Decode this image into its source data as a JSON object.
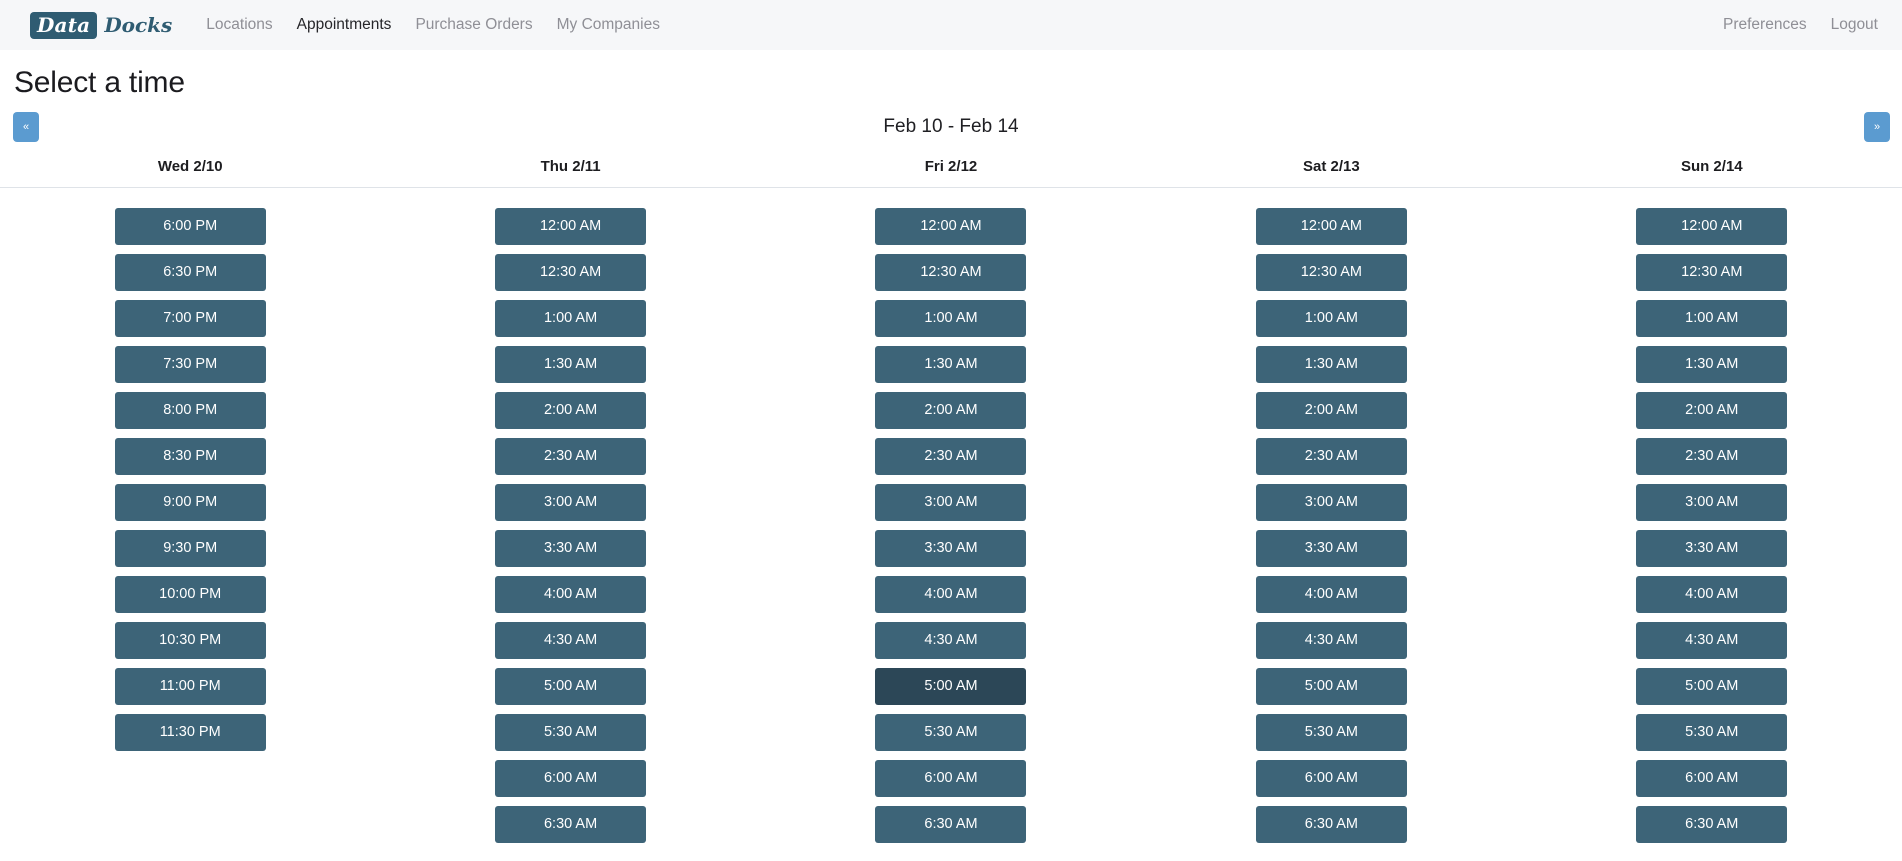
{
  "navbar": {
    "brand": {
      "box_text": "Data",
      "word_text": "Docks"
    },
    "links": [
      {
        "label": "Locations",
        "active": false
      },
      {
        "label": "Appointments",
        "active": true
      },
      {
        "label": "Purchase Orders",
        "active": false
      },
      {
        "label": "My Companies",
        "active": false
      }
    ],
    "right_links": [
      {
        "label": "Preferences"
      },
      {
        "label": "Logout"
      }
    ]
  },
  "page": {
    "title": "Select a time"
  },
  "week_nav": {
    "prev_label": "«",
    "next_label": "»",
    "range_label": "Feb 10 - Feb 14"
  },
  "colors": {
    "slot": "#3d6478",
    "slot_hovered": "#2c4757",
    "nav_button": "#5b9bd0",
    "brand": "#2f5c72",
    "navbar_bg": "#f6f7f9"
  },
  "columns": [
    {
      "header": "Wed 2/10",
      "slots": [
        {
          "label": "6:00 PM",
          "hovered": false
        },
        {
          "label": "6:30 PM",
          "hovered": false
        },
        {
          "label": "7:00 PM",
          "hovered": false
        },
        {
          "label": "7:30 PM",
          "hovered": false
        },
        {
          "label": "8:00 PM",
          "hovered": false
        },
        {
          "label": "8:30 PM",
          "hovered": false
        },
        {
          "label": "9:00 PM",
          "hovered": false
        },
        {
          "label": "9:30 PM",
          "hovered": false
        },
        {
          "label": "10:00 PM",
          "hovered": false
        },
        {
          "label": "10:30 PM",
          "hovered": false
        },
        {
          "label": "11:00 PM",
          "hovered": false
        },
        {
          "label": "11:30 PM",
          "hovered": false
        }
      ]
    },
    {
      "header": "Thu 2/11",
      "slots": [
        {
          "label": "12:00 AM",
          "hovered": false
        },
        {
          "label": "12:30 AM",
          "hovered": false
        },
        {
          "label": "1:00 AM",
          "hovered": false
        },
        {
          "label": "1:30 AM",
          "hovered": false
        },
        {
          "label": "2:00 AM",
          "hovered": false
        },
        {
          "label": "2:30 AM",
          "hovered": false
        },
        {
          "label": "3:00 AM",
          "hovered": false
        },
        {
          "label": "3:30 AM",
          "hovered": false
        },
        {
          "label": "4:00 AM",
          "hovered": false
        },
        {
          "label": "4:30 AM",
          "hovered": false
        },
        {
          "label": "5:00 AM",
          "hovered": false
        },
        {
          "label": "5:30 AM",
          "hovered": false
        },
        {
          "label": "6:00 AM",
          "hovered": false
        },
        {
          "label": "6:30 AM",
          "hovered": false
        }
      ]
    },
    {
      "header": "Fri 2/12",
      "slots": [
        {
          "label": "12:00 AM",
          "hovered": false
        },
        {
          "label": "12:30 AM",
          "hovered": false
        },
        {
          "label": "1:00 AM",
          "hovered": false
        },
        {
          "label": "1:30 AM",
          "hovered": false
        },
        {
          "label": "2:00 AM",
          "hovered": false
        },
        {
          "label": "2:30 AM",
          "hovered": false
        },
        {
          "label": "3:00 AM",
          "hovered": false
        },
        {
          "label": "3:30 AM",
          "hovered": false
        },
        {
          "label": "4:00 AM",
          "hovered": false
        },
        {
          "label": "4:30 AM",
          "hovered": false
        },
        {
          "label": "5:00 AM",
          "hovered": true
        },
        {
          "label": "5:30 AM",
          "hovered": false
        },
        {
          "label": "6:00 AM",
          "hovered": false
        },
        {
          "label": "6:30 AM",
          "hovered": false
        }
      ]
    },
    {
      "header": "Sat 2/13",
      "slots": [
        {
          "label": "12:00 AM",
          "hovered": false
        },
        {
          "label": "12:30 AM",
          "hovered": false
        },
        {
          "label": "1:00 AM",
          "hovered": false
        },
        {
          "label": "1:30 AM",
          "hovered": false
        },
        {
          "label": "2:00 AM",
          "hovered": false
        },
        {
          "label": "2:30 AM",
          "hovered": false
        },
        {
          "label": "3:00 AM",
          "hovered": false
        },
        {
          "label": "3:30 AM",
          "hovered": false
        },
        {
          "label": "4:00 AM",
          "hovered": false
        },
        {
          "label": "4:30 AM",
          "hovered": false
        },
        {
          "label": "5:00 AM",
          "hovered": false
        },
        {
          "label": "5:30 AM",
          "hovered": false
        },
        {
          "label": "6:00 AM",
          "hovered": false
        },
        {
          "label": "6:30 AM",
          "hovered": false
        }
      ]
    },
    {
      "header": "Sun 2/14",
      "slots": [
        {
          "label": "12:00 AM",
          "hovered": false
        },
        {
          "label": "12:30 AM",
          "hovered": false
        },
        {
          "label": "1:00 AM",
          "hovered": false
        },
        {
          "label": "1:30 AM",
          "hovered": false
        },
        {
          "label": "2:00 AM",
          "hovered": false
        },
        {
          "label": "2:30 AM",
          "hovered": false
        },
        {
          "label": "3:00 AM",
          "hovered": false
        },
        {
          "label": "3:30 AM",
          "hovered": false
        },
        {
          "label": "4:00 AM",
          "hovered": false
        },
        {
          "label": "4:30 AM",
          "hovered": false
        },
        {
          "label": "5:00 AM",
          "hovered": false
        },
        {
          "label": "5:30 AM",
          "hovered": false
        },
        {
          "label": "6:00 AM",
          "hovered": false
        },
        {
          "label": "6:30 AM",
          "hovered": false
        }
      ]
    }
  ]
}
